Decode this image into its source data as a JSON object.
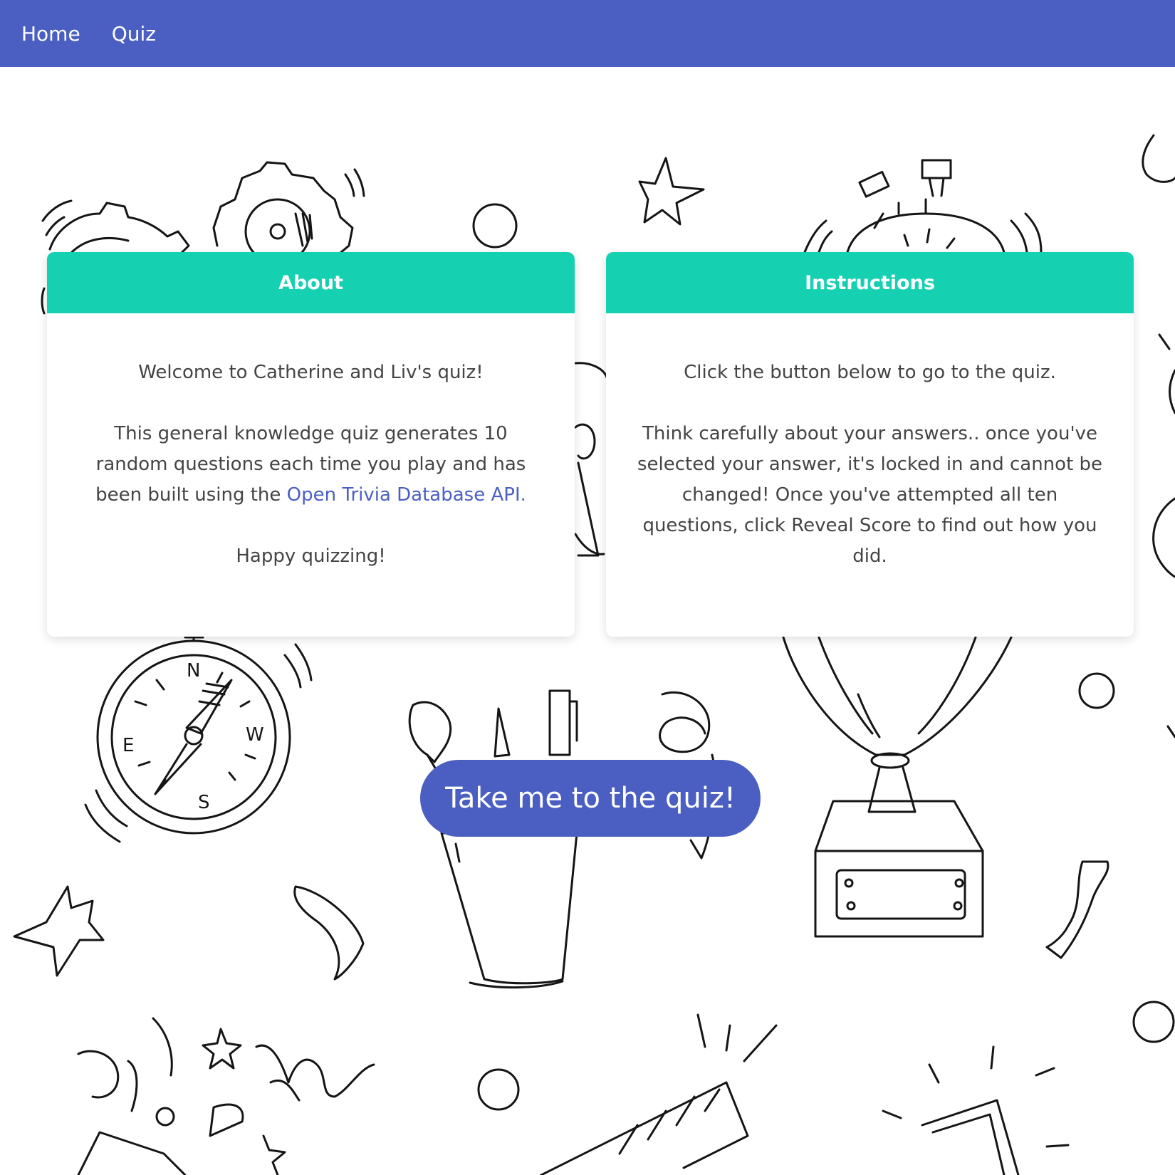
{
  "nav": {
    "home_label": "Home",
    "quiz_label": "Quiz",
    "bg_color": "#4a5fc1"
  },
  "about_card": {
    "title": "About",
    "welcome": "Welcome to Catherine and Liv's quiz!",
    "description_prefix": "This general knowledge quiz generates 10 random questions each time you play and has been built using the ",
    "api_link_text": "Open Trivia Database API.",
    "closing": "Happy quizzing!"
  },
  "instructions_card": {
    "title": "Instructions",
    "intro": "Click the button below to go to the quiz.",
    "details": "Think carefully about your answers.. once you've selected your answer, it's locked in and cannot be changed! Once you've attempted all ten questions, click Reveal Score to find out how you did."
  },
  "cta_button": {
    "label": "Take me to the quiz!"
  },
  "colors": {
    "accent": "#4a5fc1",
    "card_header": "#16d1b1",
    "text": "#444444"
  },
  "background_icons": [
    "gears-icon",
    "stopwatch-icon",
    "compass-icon",
    "pencil-cup-icon",
    "trophy-icon",
    "star-icon",
    "confetti-icon",
    "clapperboard-icon",
    "circle-icon"
  ]
}
